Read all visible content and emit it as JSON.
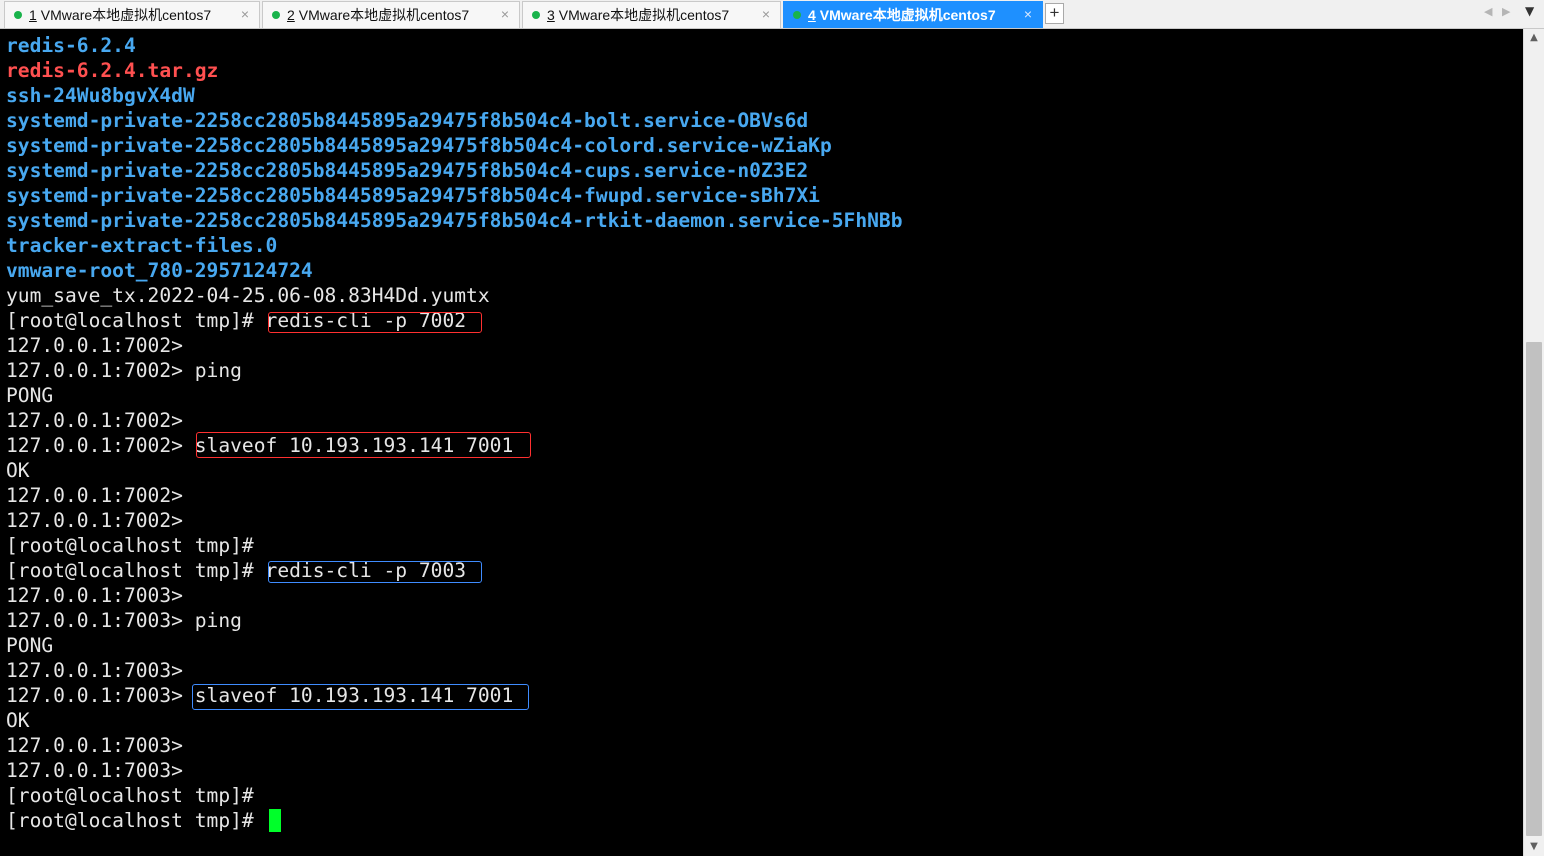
{
  "tabs": [
    {
      "num": "1",
      "title": "VMware本地虚拟机centos7",
      "active": false
    },
    {
      "num": "2",
      "title": "VMware本地虚拟机centos7",
      "active": false
    },
    {
      "num": "3",
      "title": "VMware本地虚拟机centos7",
      "active": false
    },
    {
      "num": "4",
      "title": "VMware本地虚拟机centos7",
      "active": true
    }
  ],
  "tab_close_symbol": "×",
  "new_tab_symbol": "+",
  "icons": {
    "close": "close-icon",
    "new_tab": "plus-icon",
    "scroll_left": "chevron-left-icon",
    "scroll_right": "chevron-right-icon",
    "tab_list": "chevron-down-icon",
    "scroll_up": "arrow-up-icon",
    "scroll_down": "arrow-down-icon",
    "connected": "status-dot-icon"
  },
  "colors": {
    "terminal_bg": "#000000",
    "text": "#e6e6e6",
    "directory": "#48a8f0",
    "archive": "#ff5050",
    "cursor": "#00ff2a",
    "active_tab": "#1e90ff",
    "status_dot": "#19b34b",
    "highlight_red": "#ff3030",
    "highlight_blue": "#3f8cff"
  },
  "terminal": {
    "lines": [
      {
        "text": "redis-6.2.4",
        "kind": "dir"
      },
      {
        "text": "redis-6.2.4.tar.gz",
        "kind": "arch"
      },
      {
        "text": "ssh-24Wu8bgvX4dW",
        "kind": "dir"
      },
      {
        "text": "systemd-private-2258cc2805b8445895a29475f8b504c4-bolt.service-OBVs6d",
        "kind": "dir"
      },
      {
        "text": "systemd-private-2258cc2805b8445895a29475f8b504c4-colord.service-wZiaKp",
        "kind": "dir"
      },
      {
        "text": "systemd-private-2258cc2805b8445895a29475f8b504c4-cups.service-n0Z3E2",
        "kind": "dir"
      },
      {
        "text": "systemd-private-2258cc2805b8445895a29475f8b504c4-fwupd.service-sBh7Xi",
        "kind": "dir"
      },
      {
        "text": "systemd-private-2258cc2805b8445895a29475f8b504c4-rtkit-daemon.service-5FhNBb",
        "kind": "dir"
      },
      {
        "text": "tracker-extract-files.0",
        "kind": "dir"
      },
      {
        "text": "vmware-root_780-2957124724",
        "kind": "dir"
      },
      {
        "text": "yum_save_tx.2022-04-25.06-08.83H4Dd.yumtx",
        "kind": "plain"
      },
      {
        "text": "[root@localhost tmp]# redis-cli -p 7002",
        "kind": "plain"
      },
      {
        "text": "127.0.0.1:7002>",
        "kind": "plain"
      },
      {
        "text": "127.0.0.1:7002> ping",
        "kind": "plain"
      },
      {
        "text": "PONG",
        "kind": "plain"
      },
      {
        "text": "127.0.0.1:7002>",
        "kind": "plain"
      },
      {
        "text": "127.0.0.1:7002> slaveof 10.193.193.141 7001",
        "kind": "plain"
      },
      {
        "text": "OK",
        "kind": "plain"
      },
      {
        "text": "127.0.0.1:7002>",
        "kind": "plain"
      },
      {
        "text": "127.0.0.1:7002>",
        "kind": "plain"
      },
      {
        "text": "[root@localhost tmp]#",
        "kind": "plain"
      },
      {
        "text": "[root@localhost tmp]# redis-cli -p 7003",
        "kind": "plain"
      },
      {
        "text": "127.0.0.1:7003>",
        "kind": "plain"
      },
      {
        "text": "127.0.0.1:7003> ping",
        "kind": "plain"
      },
      {
        "text": "PONG",
        "kind": "plain"
      },
      {
        "text": "127.0.0.1:7003>",
        "kind": "plain"
      },
      {
        "text": "127.0.0.1:7003> slaveof 10.193.193.141 7001",
        "kind": "plain"
      },
      {
        "text": "OK",
        "kind": "plain"
      },
      {
        "text": "127.0.0.1:7003>",
        "kind": "plain"
      },
      {
        "text": "127.0.0.1:7003>",
        "kind": "plain"
      },
      {
        "text": "[root@localhost tmp]#",
        "kind": "plain"
      },
      {
        "text": "[root@localhost tmp]# ",
        "kind": "plain"
      }
    ]
  },
  "scrollbar": {
    "position_fraction": 0.4
  }
}
